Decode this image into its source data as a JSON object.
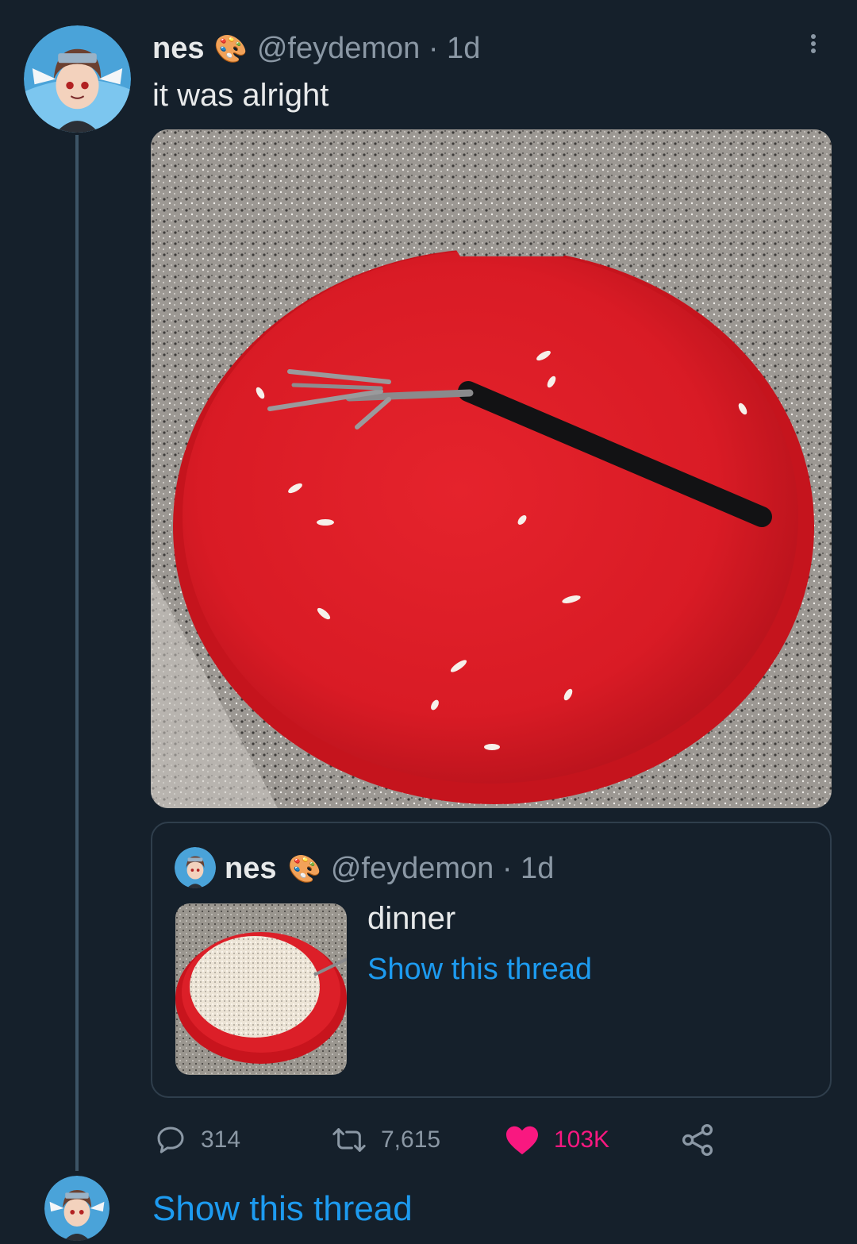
{
  "tweet": {
    "author_name": "nes",
    "author_emoji": "🎨",
    "handle_time": "@feydemon · 1d",
    "text": "it was alright",
    "more_icon": "ellipsis-vertical-icon",
    "media_description_icon": "photo-red-bowl-bent-fork"
  },
  "quote": {
    "author_name": "nes",
    "author_emoji": "🎨",
    "handle_time": "@feydemon · 1d",
    "text": "dinner",
    "link": "Show this thread"
  },
  "actions": {
    "replies": "314",
    "retweets": "7,615",
    "likes": "103K",
    "reply_icon": "speech-bubble-icon",
    "retweet_icon": "retweet-icon",
    "like_icon": "heart-icon",
    "share_icon": "share-icon"
  },
  "footer": {
    "show_thread": "Show this thread"
  },
  "colors": {
    "background": "#15202b",
    "link": "#1d9bf0",
    "like": "#f91880",
    "muted": "#8b98a5"
  }
}
